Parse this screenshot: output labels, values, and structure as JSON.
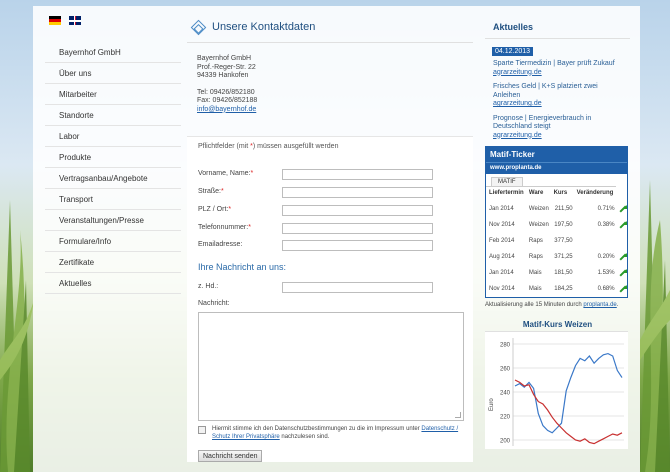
{
  "colors": {
    "accent": "#1f5fa8",
    "title": "#1f4f80",
    "required": "#dd2222",
    "up_arrow": "#2a9a2a",
    "chart_blue": "#3a78c8",
    "chart_red": "#c83030"
  },
  "languages": [
    {
      "code": "de",
      "icon": "german-flag-icon"
    },
    {
      "code": "en",
      "icon": "uk-flag-icon"
    }
  ],
  "nav": {
    "items": [
      "Bayernhof GmbH",
      "Über uns",
      "Mitarbeiter",
      "Standorte",
      "Labor",
      "Produkte",
      "Vertragsanbau/Angebote",
      "Transport",
      "Veranstaltungen/Presse",
      "Formulare/Info",
      "Zertifikate",
      "Aktuelles"
    ]
  },
  "main": {
    "title": "Unsere Kontaktdaten",
    "address": {
      "company": "Bayernhof GmbH",
      "street": "Prof.-Reger-Str. 22",
      "city": "94339 Hankofen",
      "tel": "Tel: 09426/852180",
      "fax": "Fax: 09426/852188",
      "email": "info@bayernhof.de"
    },
    "form": {
      "required_note_before": "Pflichtfelder (mit ",
      "required_note_star": "*",
      "required_note_after": ") müssen ausgefüllt werden",
      "fields": {
        "name": "Vorname, Name:",
        "street": "Straße:",
        "zip": "PLZ / Ort:",
        "phone": "Telefonnummer:",
        "email": "Emailadresse:",
        "attn": "z. Hd.:",
        "message": "Nachricht:"
      },
      "star": "*",
      "message_heading": "Ihre Nachricht an uns:",
      "consent_text": "Hiermit stimme ich den Datenschutzbestimmungen zu die im Impressum unter ",
      "consent_link": "Datenschutz / Schutz Ihrer Privatsphäre",
      "consent_after": " nachzulesen sind.",
      "submit_label": "Nachricht senden"
    }
  },
  "sidebar_right": {
    "aktuelles_title": "Aktuelles",
    "date": "04.12.2013",
    "news": [
      {
        "text": "Sparte Tiermedizin | Bayer prüft Zukauf",
        "source": "agrarzeitung.de"
      },
      {
        "text": "Frisches Geld | K+S platziert zwei Anleihen",
        "source": "agrarzeitung.de"
      },
      {
        "text": "Prognose | Energieverbrauch in Deutschland steigt",
        "source": "agrarzeitung.de"
      }
    ],
    "ticker": {
      "title": "Matif-Ticker",
      "subtitle": "www.proplanta.de",
      "tab": "MATIF",
      "headers": [
        "Liefertermin",
        "Ware",
        "Kurs",
        "Veränderung"
      ],
      "rows": [
        {
          "date": "Jan 2014",
          "ware": "Weizen",
          "kurs": "211,50",
          "change": "0.71%",
          "arrow": true
        },
        {
          "date": "Nov 2014",
          "ware": "Weizen",
          "kurs": "197,50",
          "change": "0.38%",
          "arrow": true
        },
        {
          "date": "Feb 2014",
          "ware": "Raps",
          "kurs": "377,50",
          "change": "",
          "arrow": false
        },
        {
          "date": "Aug 2014",
          "ware": "Raps",
          "kurs": "371,25",
          "change": "0.20%",
          "arrow": true
        },
        {
          "date": "Jan 2014",
          "ware": "Mais",
          "kurs": "181,50",
          "change": "1.53%",
          "arrow": true
        },
        {
          "date": "Nov 2014",
          "ware": "Mais",
          "kurs": "184,25",
          "change": "0.68%",
          "arrow": true
        }
      ],
      "update_text": "Aktualisierung alle 15 Minuten durch ",
      "update_link": "proplanta.de",
      "update_after": "."
    }
  },
  "chart_data": {
    "type": "line",
    "title": "Matif-Kurs Weizen",
    "ylabel": "Euro",
    "yticks": [
      200,
      220,
      240,
      260,
      280
    ],
    "ylim": [
      195,
      285
    ],
    "grid": true,
    "series": [
      {
        "values": [
          245,
          247,
          244,
          248,
          243,
          222,
          212,
          208,
          206,
          210,
          214,
          241,
          252,
          262,
          268,
          266,
          270,
          264,
          268,
          271,
          272,
          270,
          258,
          252
        ]
      },
      {
        "values": [
          250,
          248,
          245,
          246,
          238,
          232,
          230,
          225,
          219,
          214,
          210,
          206,
          203,
          200,
          199,
          201,
          198,
          197,
          199,
          201,
          203,
          205,
          204,
          206
        ]
      }
    ]
  }
}
